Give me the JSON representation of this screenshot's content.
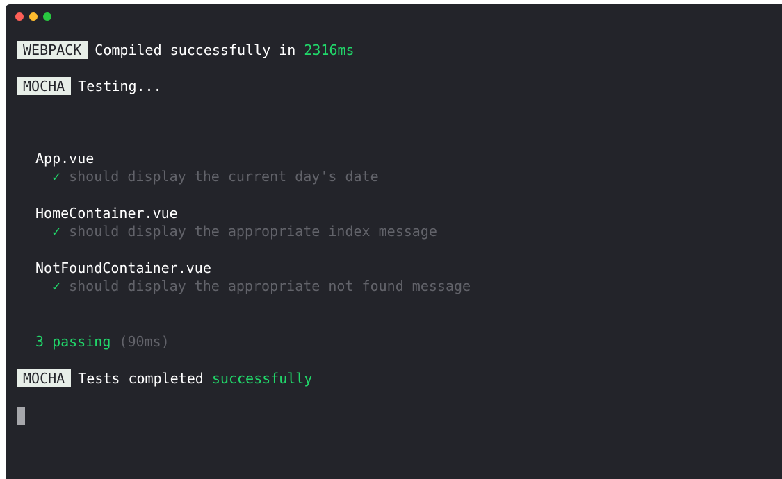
{
  "window": {
    "traffic_lights": {
      "close_color": "#fe5f57",
      "minimize_color": "#febc2e",
      "zoom_color": "#28c840"
    }
  },
  "terminal": {
    "webpack": {
      "tag": "WEBPACK",
      "message": "Compiled successfully in ",
      "time": "2316ms"
    },
    "mocha_start": {
      "tag": "MOCHA",
      "message": "Testing..."
    },
    "suites": [
      {
        "name": "App.vue",
        "check": "✓",
        "test": "should display the current day's date"
      },
      {
        "name": "HomeContainer.vue",
        "check": "✓",
        "test": "should display the appropriate index message"
      },
      {
        "name": "NotFoundContainer.vue",
        "check": "✓",
        "test": "should display the appropriate not found message"
      }
    ],
    "summary": {
      "passing": "3 passing",
      "duration": "(90ms)"
    },
    "mocha_end": {
      "tag": "MOCHA",
      "message": "Tests completed ",
      "status": "successfully"
    }
  },
  "colors": {
    "background": "#23242a",
    "success": "#21d76a",
    "muted": "#62636a",
    "tag_background": "#e7eee8"
  }
}
